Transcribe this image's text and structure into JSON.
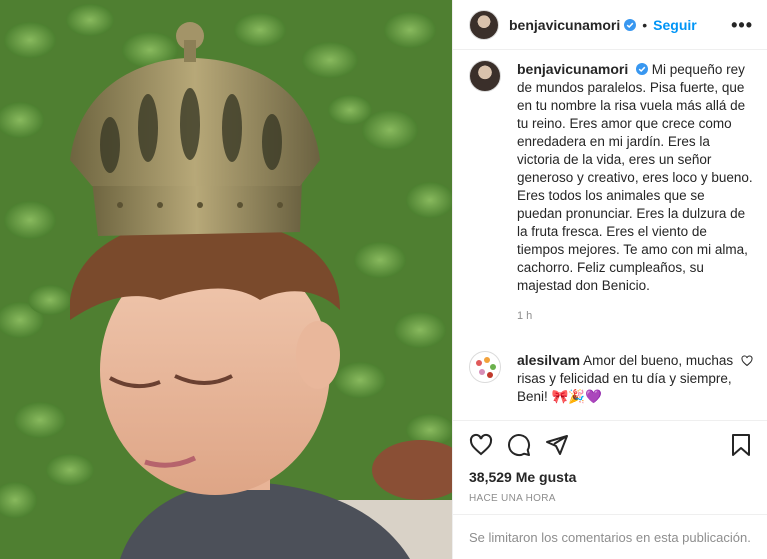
{
  "post": {
    "author": "benjavicunamori",
    "follow_label": "Seguir",
    "separator": "•",
    "more_label": "•••",
    "caption": "Mi pequeño rey de mundos paralelos. Pisa fuerte, que en tu nombre la risa vuela más allá de tu reino. Eres amor que crece como enredadera en mi jardín. Eres la victoria de la vida, eres un señor generoso y creativo, eres loco y bueno. Eres todos los animales que se puedan pronunciar. Eres la dulzura de la fruta fresca. Eres el viento de tiempos mejores. Te amo con mi alma, cachorro. Feliz cumpleaños, su majestad don Benicio.",
    "caption_time": "1 h",
    "likes": "38,529 Me gusta",
    "posted_ago": "HACE UNA HORA",
    "comments_disabled": "Se limitaron los comentarios en esta publicación."
  },
  "comment": {
    "author": "alesilvam",
    "text": "Amor del bueno, muchas risas y felicidad en tu día y siempre, Beni! 🎀🎉💜"
  },
  "icons": {
    "verified": "verified-badge-icon",
    "like": "heart-icon",
    "comment": "comment-icon",
    "share": "paper-plane-icon",
    "save": "bookmark-icon"
  },
  "colors": {
    "accent": "#0095f6",
    "muted": "#8e8e8e",
    "text": "#262626"
  }
}
